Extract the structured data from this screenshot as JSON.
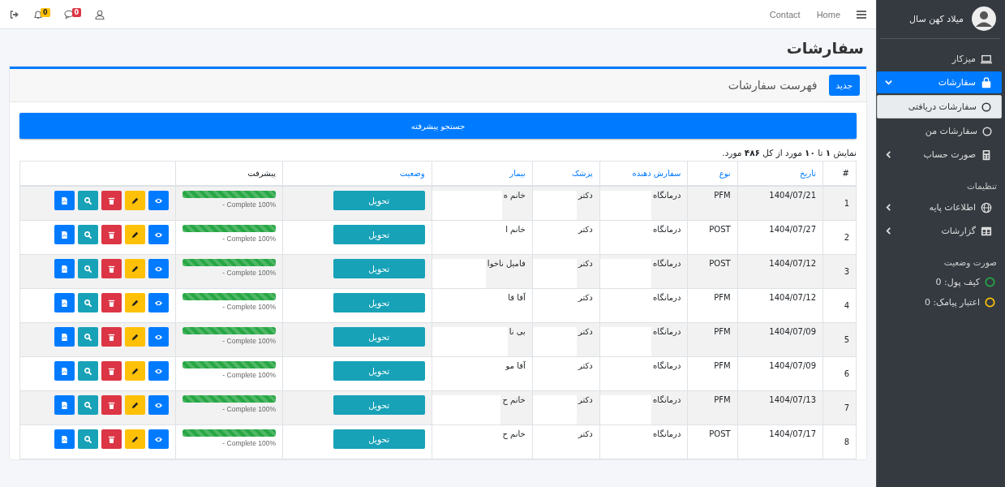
{
  "topbar": {
    "nav_links": [
      "Home",
      "Contact"
    ],
    "notifications_count": "0",
    "messages_count": "0"
  },
  "sidebar": {
    "user_name": "میلاد کهن سال",
    "menu": [
      {
        "kind": "link",
        "label": "میزکار",
        "selected": false
      },
      {
        "kind": "link",
        "label": "سفارشات",
        "selected": true,
        "expanded": true
      },
      {
        "kind": "sub",
        "label": "سفارشات دریافتی",
        "selected": true
      },
      {
        "kind": "sub",
        "label": "سفارشات من",
        "selected": false
      },
      {
        "kind": "link",
        "label": "صورت حساب",
        "selected": false,
        "expanded": false
      },
      {
        "kind": "header",
        "label": "تنظیمات"
      },
      {
        "kind": "link",
        "label": "اطلاعات پایه",
        "selected": false,
        "expanded": false
      },
      {
        "kind": "link",
        "label": "گزارشات",
        "selected": false,
        "expanded": false
      },
      {
        "kind": "header",
        "label": "صورت وضعیت"
      },
      {
        "kind": "status",
        "label": "کیف پول: 0",
        "color": "#28a745"
      },
      {
        "kind": "status",
        "label": "اعتبار پیامک: 0",
        "color": "#ffc107"
      }
    ]
  },
  "page_title": "سفارشات",
  "card": {
    "title": "فهرست سفارشات",
    "new_button": "جدید",
    "search_button": "جستجو پیشرفته",
    "summary": "نمایش **۱** تا **۱۰** مورد از کل **۴۸۶** مورد.",
    "table": {
      "columns": [
        {
          "label": "#",
          "sortable": false
        },
        {
          "label": "تاریخ",
          "sortable": true
        },
        {
          "label": "نوع",
          "sortable": true
        },
        {
          "label": "سفارش دهنده",
          "sortable": true
        },
        {
          "label": "پزشک",
          "sortable": true
        },
        {
          "label": "بیمار",
          "sortable": true
        },
        {
          "label": "وضعیت",
          "sortable": true
        },
        {
          "label": "پیشرفت",
          "sortable": false
        }
      ],
      "rows": [
        {
          "number": "1",
          "date": "1404/07/21",
          "type": "PFM",
          "orderer": "درمانگاه",
          "doctor": "دکتر",
          "patient": "خانم ه",
          "status": "تحویل",
          "progress": {
            "level": 1,
            "label": "- Complete 100%"
          }
        },
        {
          "number": "2",
          "date": "1404/07/27",
          "type": "POST",
          "orderer": "درمانگاه",
          "doctor": "دکتر",
          "patient": "خانم ا",
          "status": "تحویل",
          "progress": {
            "level": 1,
            "label": "- Complete 100%"
          }
        },
        {
          "number": "3",
          "date": "1404/07/12",
          "type": "POST",
          "orderer": "درمانگاه",
          "doctor": "دکتر",
          "patient": "فامیل ناخوا",
          "status": "تحویل",
          "progress": {
            "level": 1,
            "label": "- Complete 100%"
          }
        },
        {
          "number": "4",
          "date": "1404/07/12",
          "type": "PFM",
          "orderer": "درمانگاه",
          "doctor": "دکتر",
          "patient": "آقا قا",
          "status": "تحویل",
          "progress": {
            "level": 1,
            "label": "- Complete 100%"
          }
        },
        {
          "number": "5",
          "date": "1404/07/09",
          "type": "PFM",
          "orderer": "درمانگاه",
          "doctor": "دکتر",
          "patient": "بی نا",
          "status": "تحویل",
          "progress": {
            "level": 1,
            "label": "- Complete 100%"
          }
        },
        {
          "number": "6",
          "date": "1404/07/09",
          "type": "PFM",
          "orderer": "درمانگاه",
          "doctor": "دکتر",
          "patient": "آقا مو",
          "status": "تحویل",
          "progress": {
            "level": 1,
            "label": "- Complete 100%"
          }
        },
        {
          "number": "7",
          "date": "1404/07/13",
          "type": "PFM",
          "orderer": "درمانگاه",
          "doctor": "دکتر",
          "patient": "خانم ح",
          "status": "تحویل",
          "progress": {
            "level": 1,
            "label": "- Complete 100%"
          }
        },
        {
          "number": "8",
          "date": "1404/07/17",
          "type": "POST",
          "orderer": "درمانگاه",
          "doctor": "دکتر",
          "patient": "خانم ح",
          "status": "تحویل",
          "progress": {
            "level": 1,
            "label": "- Complete 100%"
          }
        }
      ]
    }
  }
}
